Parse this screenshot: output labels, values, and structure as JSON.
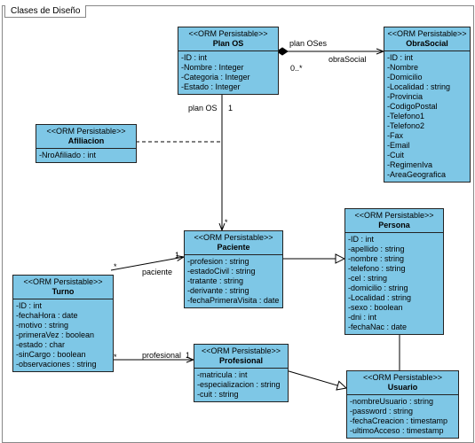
{
  "frame_title": "Clases de Diseño",
  "stereotype": "<<ORM Persistable>>",
  "classes": {
    "planos": {
      "name": "Plan OS",
      "attrs": [
        "-ID : int",
        "-Nombre : Integer",
        "-Categoria : Integer",
        "-Estado : Integer"
      ]
    },
    "obrasocial": {
      "name": "ObraSocial",
      "attrs": [
        "-ID : int",
        "-Nombre",
        "-Domicilio",
        "-Localidad : string",
        "-Provincia",
        "-CodigoPostal",
        "-Telefono1",
        "-Telefono2",
        "-Fax",
        "-Email",
        "-Cuit",
        "-RegimenIva",
        "-AreaGeografica"
      ]
    },
    "afiliacion": {
      "name": "Afiliacion",
      "attrs": [
        "-NroAfiliado : int"
      ]
    },
    "paciente": {
      "name": "Paciente",
      "attrs": [
        "-profesion : string",
        "-estadoCivil : string",
        "-tratante : string",
        "-derivante : string",
        "-fechaPrimeraVisita : date"
      ]
    },
    "persona": {
      "name": "Persona",
      "attrs": [
        "-ID : int",
        "-apellido : string",
        "-nombre : string",
        "-telefono : string",
        "-cel : string",
        "-domicilio : string",
        "-Localidad : string",
        "-sexo : boolean",
        "-dni : int",
        "-fechaNac : date"
      ]
    },
    "turno": {
      "name": "Turno",
      "attrs": [
        "-ID : int",
        "-fechaHora : date",
        "-motivo : string",
        "-primeraVez : boolean",
        "-estado : char",
        "-sinCargo : boolean",
        "-observaciones : string"
      ]
    },
    "profesional": {
      "name": "Profesional",
      "attrs": [
        "-matricula : int",
        "-especializacion : string",
        "-cuit : string"
      ]
    },
    "usuario": {
      "name": "Usuario",
      "attrs": [
        "-nombreUsuario : string",
        "-password : string",
        "-fechaCreacion : timestamp",
        "-ultimoAcceso : timestamp"
      ]
    }
  },
  "labels": {
    "planOSes": "plan OSes",
    "obraSocial": "obraSocial",
    "zeroStar": "0..*",
    "planOS": "plan OS",
    "one_a": "1",
    "star_a": "*",
    "paciente": "paciente",
    "one_b": "1",
    "star_b": "*",
    "profesional": "profesional",
    "star_c": "*",
    "one_c": "1"
  }
}
